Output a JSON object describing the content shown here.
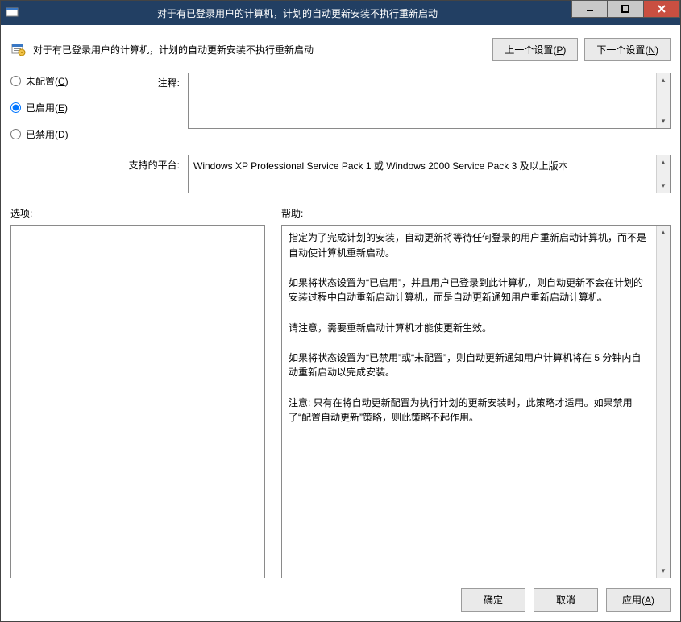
{
  "window": {
    "title": "对于有已登录用户的计算机，计划的自动更新安装不执行重新启动"
  },
  "header": {
    "policy_name": "对于有已登录用户的计算机，计划的自动更新安装不执行重新启动",
    "prev_setting": "上一个设置(P)",
    "next_setting": "下一个设置(N)"
  },
  "state": {
    "not_configured": "未配置(C)",
    "enabled": "已启用(E)",
    "disabled": "已禁用(D)",
    "selected": "enabled"
  },
  "fields": {
    "comment_label": "注释:",
    "comment_value": "",
    "platform_label": "支持的平台:",
    "platform_value": "Windows XP Professional Service Pack 1 或 Windows 2000 Service Pack 3 及以上版本"
  },
  "sections": {
    "options_label": "选项:",
    "help_label": "帮助:"
  },
  "help": {
    "text": "指定为了完成计划的安装，自动更新将等待任何登录的用户重新启动计算机，而不是自动使计算机重新启动。\n\n如果将状态设置为“已启用”，并且用户已登录到此计算机，则自动更新不会在计划的安装过程中自动重新启动计算机，而是自动更新通知用户重新启动计算机。\n\n请注意，需要重新启动计算机才能使更新生效。\n\n如果将状态设置为“已禁用”或“未配置”，则自动更新通知用户计算机将在 5 分钟内自动重新启动以完成安装。\n\n注意: 只有在将自动更新配置为执行计划的更新安装时，此策略才适用。如果禁用了“配置自动更新”策略，则此策略不起作用。"
  },
  "footer": {
    "ok": "确定",
    "cancel": "取消",
    "apply": "应用(A)"
  }
}
